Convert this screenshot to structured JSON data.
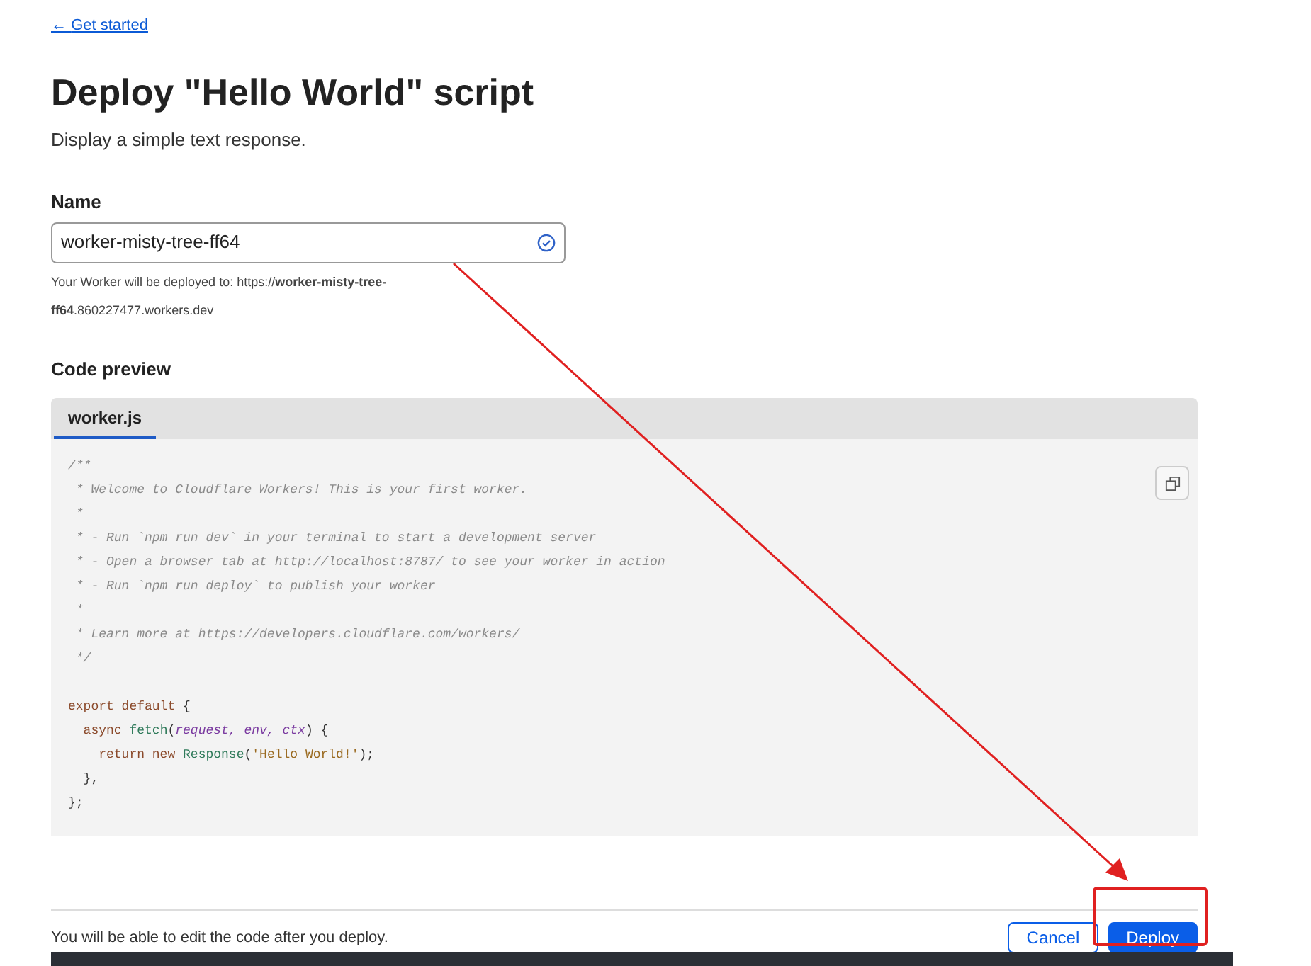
{
  "back_link": {
    "arrow": "←",
    "label": "Get started"
  },
  "title": "Deploy \"Hello World\" script",
  "subtitle": "Display a simple text response.",
  "name_field": {
    "label": "Name",
    "value": "worker-misty-tree-ff64",
    "valid": true,
    "hint": "Your Worker will be deployed to: https://**worker-misty-tree-ff64**.860227477.workers.dev"
  },
  "code_preview": {
    "heading": "Code preview",
    "tabs": [
      {
        "label": "worker.js",
        "selected": true
      }
    ],
    "lines": [
      [
        {
          "kind": "comment",
          "text": "/**"
        }
      ],
      [
        {
          "kind": "comment",
          "text": " * Welcome to Cloudflare Workers! This is your first worker."
        }
      ],
      [
        {
          "kind": "comment",
          "text": " *"
        }
      ],
      [
        {
          "kind": "comment",
          "text": " * - Run `npm run dev` in your terminal to start a development server"
        }
      ],
      [
        {
          "kind": "comment",
          "text": " * - Open a browser tab at http://localhost:8787/ to see your worker in action"
        }
      ],
      [
        {
          "kind": "comment",
          "text": " * - Run `npm run deploy` to publish your worker"
        }
      ],
      [
        {
          "kind": "comment",
          "text": " *"
        }
      ],
      [
        {
          "kind": "comment",
          "text": " * Learn more at https://developers.cloudflare.com/workers/"
        }
      ],
      [
        {
          "kind": "comment",
          "text": " */"
        }
      ]
    ],
    "body_lines": [
      [
        {
          "kind": "keyword",
          "text": "export default"
        },
        {
          "kind": "plain",
          "text": " {"
        }
      ],
      [
        {
          "kind": "keyword",
          "text": "  async"
        },
        {
          "kind": "function",
          "text": " fetch"
        },
        {
          "kind": "plain",
          "text": "("
        },
        {
          "kind": "param",
          "text": "request, env, ctx"
        },
        {
          "kind": "plain",
          "text": ") {"
        }
      ],
      [
        {
          "kind": "keyword",
          "text": "    return new"
        },
        {
          "kind": "class",
          "text": " Response"
        },
        {
          "kind": "plain",
          "text": "("
        },
        {
          "kind": "string",
          "text": "'Hello World!'"
        },
        {
          "kind": "plain",
          "text": ");"
        }
      ],
      [
        {
          "kind": "plain",
          "text": "  },"
        }
      ],
      [
        {
          "kind": "plain",
          "text": "};"
        }
      ]
    ]
  },
  "footer": {
    "note": "You will be able to edit the code after you deploy.",
    "buttons": [
      {
        "label": "Cancel",
        "kind": "secondary"
      },
      {
        "label": "Deploy",
        "kind": "primary"
      }
    ]
  }
}
